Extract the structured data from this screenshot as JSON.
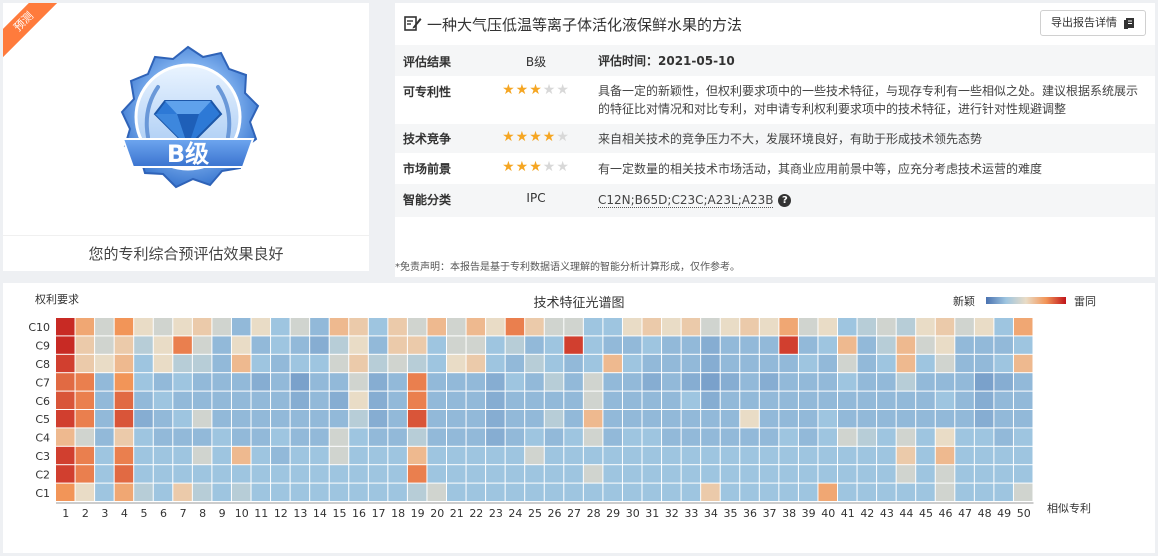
{
  "badge": {
    "ribbon": "预测",
    "grade": "B级",
    "caption": "您的专利综合预评估效果良好"
  },
  "report": {
    "title": "一种大气压低温等离子体活化液保鲜水果的方法",
    "export_label": "导出报告详情",
    "rows": {
      "result": {
        "label": "评估结果",
        "grade": "B级",
        "time": "评估时间：2021-05-10"
      },
      "patentability": {
        "label": "可专利性",
        "stars": 3,
        "desc": "具备一定的新颖性，但权利要求项中的一些技术特征，与现存专利有一些相似之处。建议根据系统展示的特征比对情况和对比专利，对申请专利权利要求项中的技术特征，进行针对性规避调整"
      },
      "competition": {
        "label": "技术竞争",
        "stars": 4,
        "desc": "来自相关技术的竞争压力不大，发展环境良好，有助于形成技术领先态势"
      },
      "market": {
        "label": "市场前景",
        "stars": 3,
        "desc": "有一定数量的相关技术市场活动，其商业应用前景中等，应充分考虑技术运营的难度"
      },
      "classification": {
        "label": "智能分类",
        "scheme": "IPC",
        "codes": "C12N;B65D;C23C;A23L;A23B"
      }
    },
    "disclaimer": "*免责声明：本报告是基于专利数据语义理解的智能分析计算形成，仅作参考。"
  },
  "chart_data": {
    "type": "heatmap",
    "title": "技术特征光谱图",
    "ylabel": "权利要求",
    "xlabel": "相似专利",
    "legend_low": "新颖",
    "legend_high": "雷同",
    "y_categories": [
      "C10",
      "C9",
      "C8",
      "C7",
      "C6",
      "C5",
      "C4",
      "C3",
      "C2",
      "C1"
    ],
    "x_categories": [
      "1",
      "2",
      "3",
      "4",
      "5",
      "6",
      "7",
      "8",
      "9",
      "10",
      "11",
      "12",
      "13",
      "14",
      "15",
      "16",
      "17",
      "18",
      "19",
      "20",
      "21",
      "22",
      "23",
      "24",
      "25",
      "26",
      "27",
      "28",
      "29",
      "30",
      "31",
      "32",
      "33",
      "34",
      "35",
      "36",
      "37",
      "38",
      "39",
      "40",
      "41",
      "42",
      "43",
      "44",
      "45",
      "46",
      "47",
      "48",
      "49",
      "50"
    ],
    "value_range": [
      0,
      1
    ],
    "values": [
      [
        0.95,
        0.65,
        0.45,
        0.7,
        0.5,
        0.45,
        0.5,
        0.55,
        0.45,
        0.3,
        0.5,
        0.35,
        0.45,
        0.3,
        0.6,
        0.55,
        0.35,
        0.55,
        0.45,
        0.6,
        0.45,
        0.6,
        0.5,
        0.75,
        0.55,
        0.45,
        0.45,
        0.35,
        0.35,
        0.5,
        0.55,
        0.5,
        0.55,
        0.45,
        0.5,
        0.55,
        0.5,
        0.65,
        0.45,
        0.5,
        0.35,
        0.4,
        0.45,
        0.4,
        0.5,
        0.55,
        0.45,
        0.5,
        0.35,
        0.65
      ],
      [
        0.95,
        0.55,
        0.45,
        0.55,
        0.4,
        0.5,
        0.75,
        0.45,
        0.3,
        0.5,
        0.3,
        0.35,
        0.3,
        0.25,
        0.4,
        0.5,
        0.3,
        0.55,
        0.55,
        0.35,
        0.45,
        0.45,
        0.35,
        0.4,
        0.3,
        0.35,
        0.9,
        0.35,
        0.3,
        0.3,
        0.35,
        0.3,
        0.3,
        0.25,
        0.3,
        0.3,
        0.3,
        0.9,
        0.3,
        0.35,
        0.6,
        0.3,
        0.4,
        0.6,
        0.45,
        0.5,
        0.3,
        0.3,
        0.3,
        0.35
      ],
      [
        0.9,
        0.55,
        0.5,
        0.6,
        0.35,
        0.5,
        0.4,
        0.4,
        0.3,
        0.6,
        0.35,
        0.3,
        0.35,
        0.35,
        0.45,
        0.55,
        0.4,
        0.45,
        0.4,
        0.35,
        0.5,
        0.55,
        0.35,
        0.3,
        0.4,
        0.35,
        0.3,
        0.35,
        0.6,
        0.35,
        0.3,
        0.3,
        0.3,
        0.25,
        0.3,
        0.3,
        0.3,
        0.3,
        0.35,
        0.3,
        0.45,
        0.3,
        0.35,
        0.6,
        0.35,
        0.45,
        0.3,
        0.3,
        0.35,
        0.6
      ],
      [
        0.8,
        0.75,
        0.3,
        0.7,
        0.35,
        0.3,
        0.35,
        0.3,
        0.3,
        0.3,
        0.25,
        0.3,
        0.2,
        0.3,
        0.3,
        0.45,
        0.25,
        0.3,
        0.75,
        0.3,
        0.3,
        0.3,
        0.25,
        0.35,
        0.3,
        0.4,
        0.3,
        0.45,
        0.3,
        0.3,
        0.25,
        0.3,
        0.25,
        0.2,
        0.25,
        0.3,
        0.25,
        0.3,
        0.3,
        0.3,
        0.35,
        0.3,
        0.3,
        0.4,
        0.3,
        0.3,
        0.3,
        0.2,
        0.25,
        0.3
      ],
      [
        0.85,
        0.75,
        0.3,
        0.8,
        0.3,
        0.35,
        0.3,
        0.3,
        0.3,
        0.3,
        0.3,
        0.3,
        0.25,
        0.3,
        0.25,
        0.5,
        0.25,
        0.3,
        0.75,
        0.3,
        0.3,
        0.3,
        0.25,
        0.3,
        0.3,
        0.3,
        0.3,
        0.45,
        0.3,
        0.3,
        0.3,
        0.3,
        0.35,
        0.25,
        0.3,
        0.3,
        0.3,
        0.3,
        0.3,
        0.3,
        0.3,
        0.3,
        0.3,
        0.3,
        0.3,
        0.35,
        0.3,
        0.25,
        0.3,
        0.3
      ],
      [
        0.9,
        0.75,
        0.3,
        0.85,
        0.25,
        0.3,
        0.35,
        0.45,
        0.3,
        0.3,
        0.3,
        0.3,
        0.3,
        0.3,
        0.3,
        0.4,
        0.25,
        0.3,
        0.85,
        0.3,
        0.3,
        0.3,
        0.25,
        0.3,
        0.3,
        0.4,
        0.3,
        0.6,
        0.3,
        0.3,
        0.3,
        0.3,
        0.3,
        0.3,
        0.3,
        0.5,
        0.3,
        0.3,
        0.3,
        0.35,
        0.3,
        0.3,
        0.3,
        0.3,
        0.3,
        0.3,
        0.3,
        0.25,
        0.3,
        0.3
      ],
      [
        0.6,
        0.45,
        0.3,
        0.55,
        0.35,
        0.3,
        0.3,
        0.3,
        0.35,
        0.3,
        0.3,
        0.35,
        0.3,
        0.3,
        0.45,
        0.35,
        0.3,
        0.3,
        0.4,
        0.3,
        0.3,
        0.3,
        0.25,
        0.3,
        0.35,
        0.3,
        0.35,
        0.45,
        0.3,
        0.35,
        0.35,
        0.3,
        0.3,
        0.3,
        0.3,
        0.3,
        0.3,
        0.35,
        0.3,
        0.35,
        0.45,
        0.4,
        0.35,
        0.45,
        0.35,
        0.5,
        0.35,
        0.35,
        0.3,
        0.35
      ],
      [
        0.9,
        0.75,
        0.35,
        0.75,
        0.35,
        0.35,
        0.35,
        0.45,
        0.35,
        0.6,
        0.35,
        0.3,
        0.35,
        0.35,
        0.45,
        0.35,
        0.35,
        0.35,
        0.6,
        0.35,
        0.35,
        0.35,
        0.35,
        0.35,
        0.45,
        0.35,
        0.35,
        0.35,
        0.35,
        0.35,
        0.35,
        0.35,
        0.35,
        0.35,
        0.35,
        0.35,
        0.35,
        0.35,
        0.35,
        0.35,
        0.35,
        0.35,
        0.35,
        0.55,
        0.35,
        0.6,
        0.35,
        0.35,
        0.35,
        0.35
      ],
      [
        0.9,
        0.75,
        0.35,
        0.8,
        0.35,
        0.35,
        0.35,
        0.35,
        0.35,
        0.35,
        0.35,
        0.35,
        0.35,
        0.35,
        0.35,
        0.35,
        0.35,
        0.35,
        0.75,
        0.35,
        0.35,
        0.35,
        0.35,
        0.35,
        0.35,
        0.35,
        0.35,
        0.45,
        0.35,
        0.35,
        0.35,
        0.35,
        0.35,
        0.35,
        0.35,
        0.35,
        0.35,
        0.35,
        0.35,
        0.35,
        0.35,
        0.35,
        0.35,
        0.45,
        0.35,
        0.45,
        0.35,
        0.35,
        0.35,
        0.35
      ],
      [
        0.7,
        0.5,
        0.35,
        0.65,
        0.4,
        0.35,
        0.55,
        0.4,
        0.35,
        0.4,
        0.35,
        0.35,
        0.35,
        0.35,
        0.35,
        0.35,
        0.35,
        0.35,
        0.4,
        0.45,
        0.35,
        0.35,
        0.35,
        0.35,
        0.35,
        0.35,
        0.35,
        0.35,
        0.35,
        0.35,
        0.35,
        0.35,
        0.35,
        0.55,
        0.35,
        0.35,
        0.35,
        0.35,
        0.35,
        0.65,
        0.35,
        0.35,
        0.35,
        0.35,
        0.35,
        0.45,
        0.35,
        0.35,
        0.35,
        0.45
      ]
    ]
  }
}
